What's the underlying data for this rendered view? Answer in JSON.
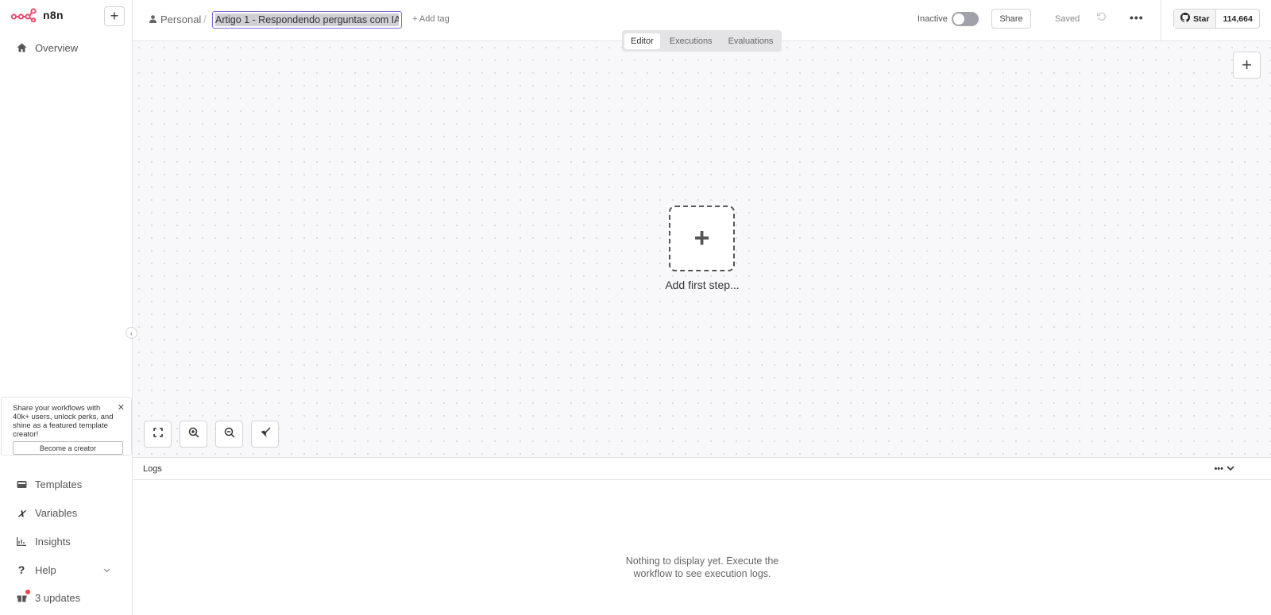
{
  "brand": {
    "name": "n8n",
    "accent": "#ea4b71"
  },
  "sidebar": {
    "overview": "Overview",
    "promo": {
      "text": "Share your workflows with 40k+ users, unlock perks, and shine as a featured template creator!",
      "button": "Become a creator"
    },
    "items": [
      {
        "label": "Templates",
        "icon": "templates-icon"
      },
      {
        "label": "Variables",
        "icon": "variables-icon"
      },
      {
        "label": "Insights",
        "icon": "insights-icon"
      },
      {
        "label": "Help",
        "icon": "help-icon"
      },
      {
        "label": "3 updates",
        "icon": "gift-icon"
      }
    ]
  },
  "header": {
    "project": "Personal",
    "workflow_name": "Artigo 1 - Respondendo perguntas com IA",
    "add_tag": "+ Add tag",
    "tabs": [
      "Editor",
      "Executions",
      "Evaluations"
    ],
    "active_tab": "Editor",
    "status": "Inactive",
    "share": "Share",
    "saved": "Saved",
    "github": {
      "star": "Star",
      "count": "114,664"
    }
  },
  "canvas": {
    "add_first_step": "Add first step..."
  },
  "logs": {
    "title": "Logs",
    "empty": "Nothing to display yet. Execute the workflow to see execution logs."
  }
}
